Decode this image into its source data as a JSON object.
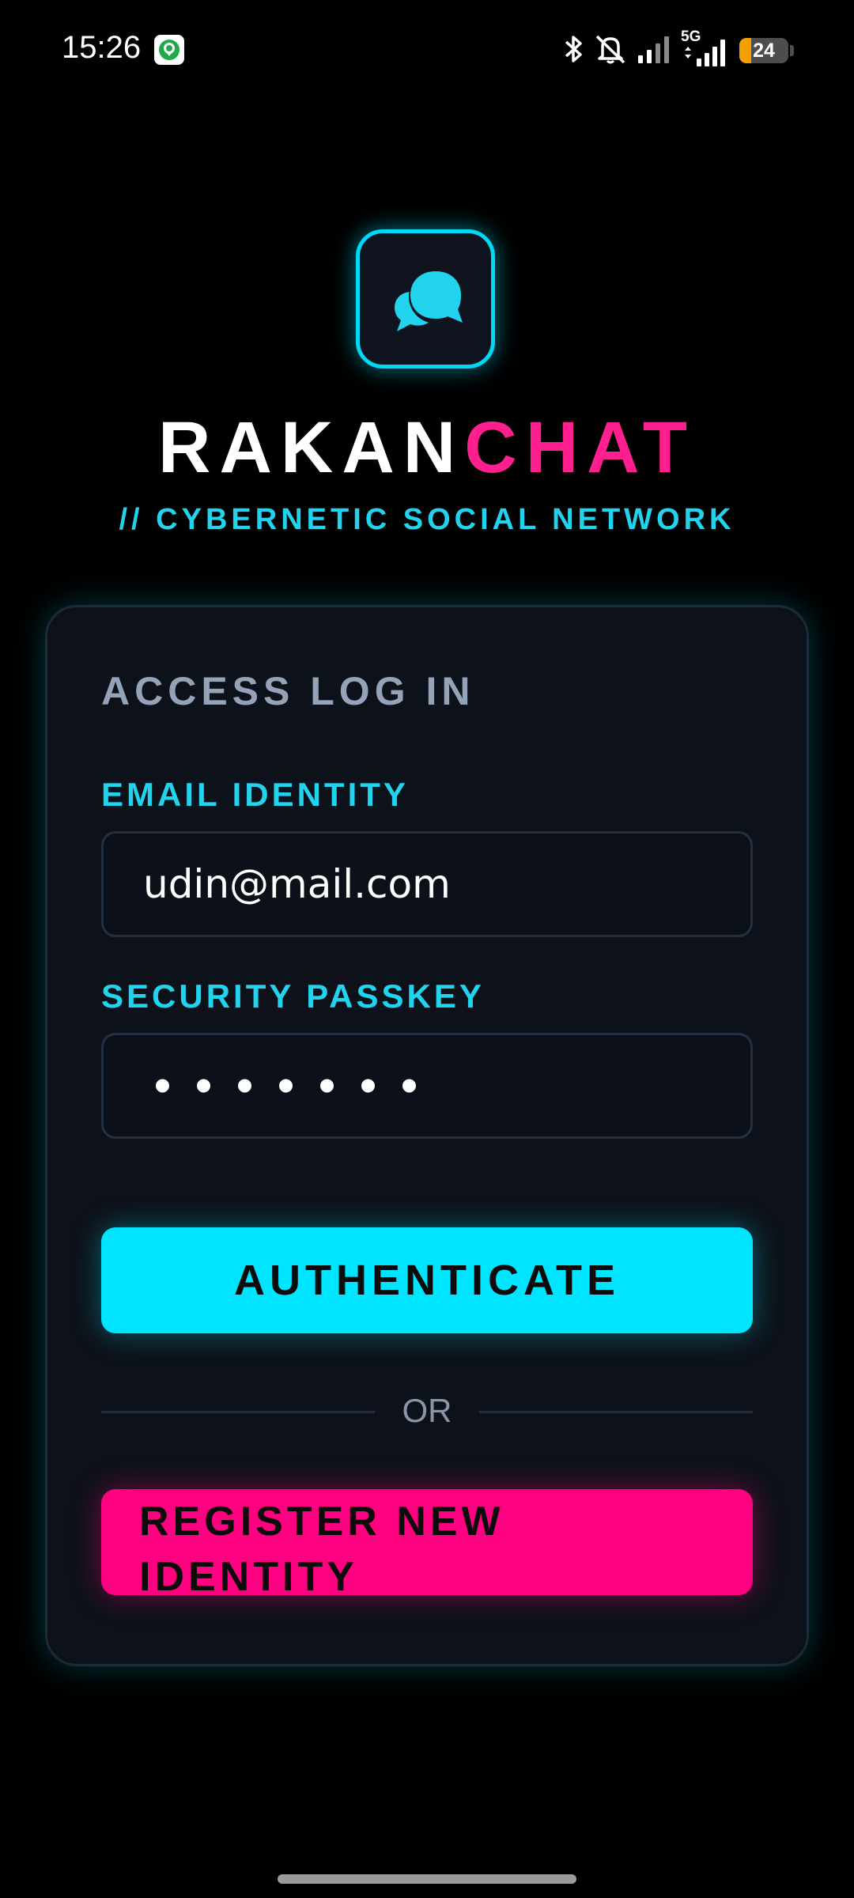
{
  "status_bar": {
    "time": "15:26",
    "network_label": "5G",
    "battery_level": "24",
    "battery_percent": 24,
    "icons": [
      "location-app-icon",
      "bluetooth-icon",
      "mute-icon",
      "signal-icon",
      "signal-5g-icon",
      "battery-icon"
    ]
  },
  "brand": {
    "name_part_1": "RAKAN",
    "name_part_2": "CHAT",
    "tagline": "// CYBERNETIC SOCIAL NETWORK",
    "logo_icon": "chat-bubbles-icon"
  },
  "login_card": {
    "title": "ACCESS LOG IN",
    "email_label": "EMAIL IDENTITY",
    "email_value": "udin@mail.com",
    "password_label": "SECURITY PASSKEY",
    "password_length": 7,
    "authenticate_label": "AUTHENTICATE",
    "divider_text": "OR",
    "register_label": "REGISTER NEW IDENTITY"
  },
  "colors": {
    "background": "#000000",
    "card": "#0d1119",
    "cyan_accent": "#00e5ff",
    "pink_accent": "#ff0080",
    "muted_text": "#94a3b8"
  }
}
